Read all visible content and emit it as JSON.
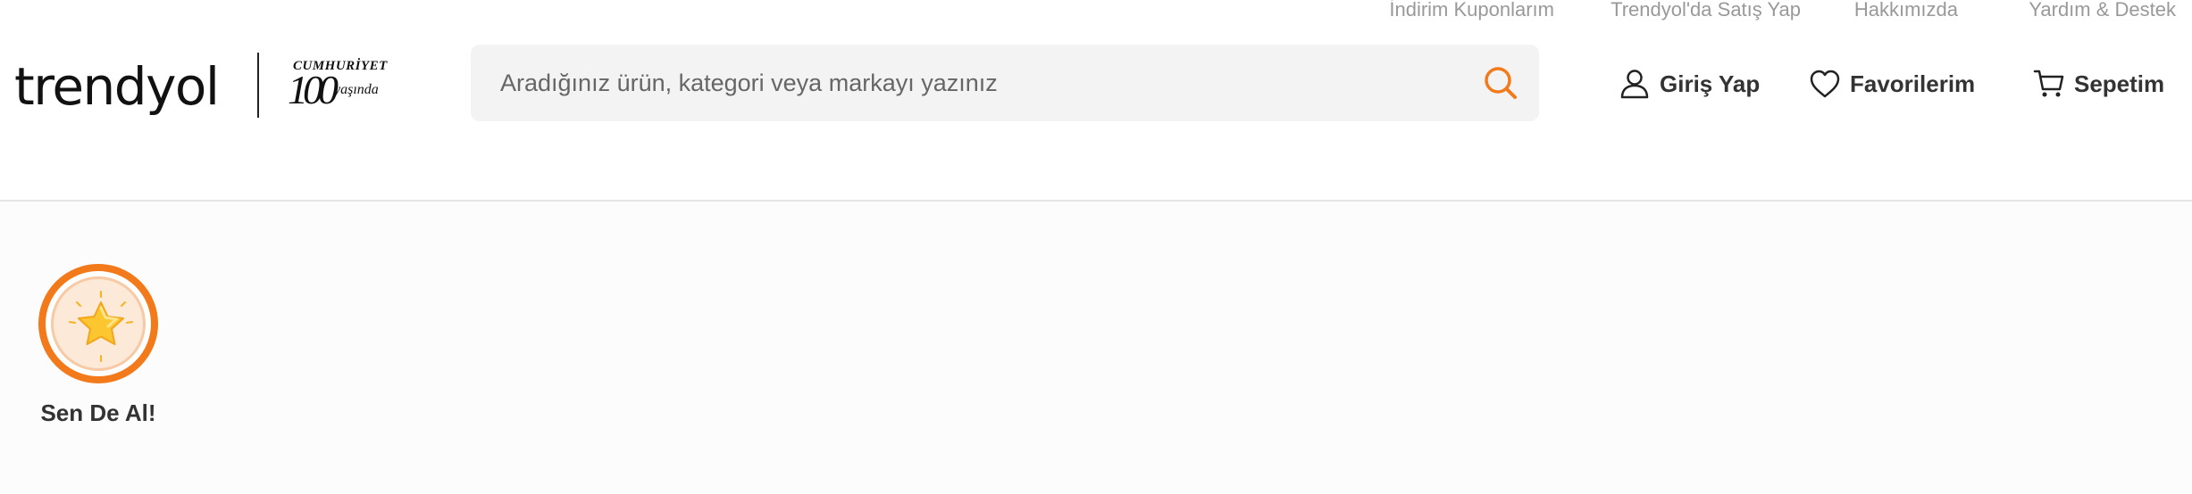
{
  "top_links": [
    {
      "label": "İndirim Kuponlarım"
    },
    {
      "label": "Trendyol'da Satış Yap"
    },
    {
      "label": "Hakkımızda"
    },
    {
      "label": "Yardım & Destek"
    }
  ],
  "logo": {
    "brand": "trendyol",
    "anniversary_top": "CUMHURİYET",
    "anniversary_number": "100",
    "anniversary_sub": "yaşında"
  },
  "search": {
    "placeholder": "Aradığınız ürün, kategori veya markayı yazınız",
    "icon": "search-icon"
  },
  "nav": {
    "login": {
      "label": "Giriş Yap",
      "icon": "user-icon"
    },
    "favorites": {
      "label": "Favorilerim",
      "icon": "heart-icon"
    },
    "cart": {
      "label": "Sepetim",
      "icon": "cart-icon"
    }
  },
  "stories": [
    {
      "label": "Sen De Al!",
      "icon": "star-icon"
    }
  ],
  "colors": {
    "accent": "#f27a1a",
    "search_bg": "#f3f3f3",
    "text": "#333333",
    "muted": "#999999"
  }
}
